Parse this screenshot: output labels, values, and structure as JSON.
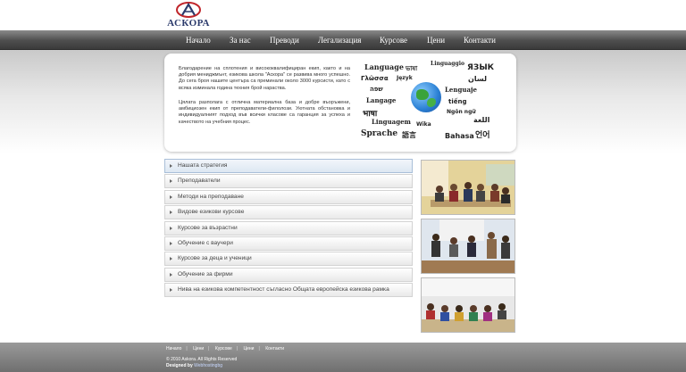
{
  "logo": {
    "text": "АСКОРА"
  },
  "nav": {
    "items": [
      "Начало",
      "За нас",
      "Преводи",
      "Легализация",
      "Курсове",
      "Цени",
      "Контакти"
    ]
  },
  "intro": {
    "paragraph1": "Благодарение на сплотения и висококвалифициран екип, както и на добрия мениджмънт, езикова школа \"Аскора\" се развива много успешно. До сега броя нашите центъра са преминали около 3000 курсисти, като с всяка изминала година техния брой нараства.",
    "paragraph2": "Цялата разполага с отлична материална база и добре въоръжени, амбициозен екип от преподаватели-филолози. Уютната обстановка и индивидуалният подход във всички класове са гаранция за успеха и качеството на учебния процес."
  },
  "languages": {
    "words": [
      "Language",
      "ভাষা",
      "Linguaggio",
      "ЯЗЫК",
      "Γλῶσσα",
      "Język",
      "لسان",
      "שפה",
      "Lenguaje",
      "Langage",
      "भाषा",
      "Linguagem",
      "Ngôn ngữ",
      "اللغة",
      "Sprache",
      "語言",
      "Wika",
      "Bahasa",
      "언어",
      "tiếng"
    ]
  },
  "menu": {
    "items": [
      "Нашата стратегия",
      "Преподаватели",
      "Методи на преподаване",
      "Видове езикови курсове",
      "Курсове за възрастни",
      "Обучение с ваучери",
      "Курсове за деца и ученици",
      "Обучение за фирми",
      "Нива на езикова компетентност съгласно Общата европейска езикова рамка"
    ]
  },
  "footer": {
    "links": [
      "Начало",
      "Цени",
      "Курсове",
      "Цени",
      "Контакти"
    ],
    "copyright": "© 2010 Askora. All Rights Reserved",
    "designed_by_label": "Designed by",
    "designed_by_name": "Webhostingbg"
  },
  "colors": {
    "nav_bg": "#4e4e4e",
    "footer_bg": "#7a7a7a",
    "logo_blue": "#2b3a6b",
    "logo_red": "#c0262b",
    "active_menu_border": "#a9bfd8"
  }
}
